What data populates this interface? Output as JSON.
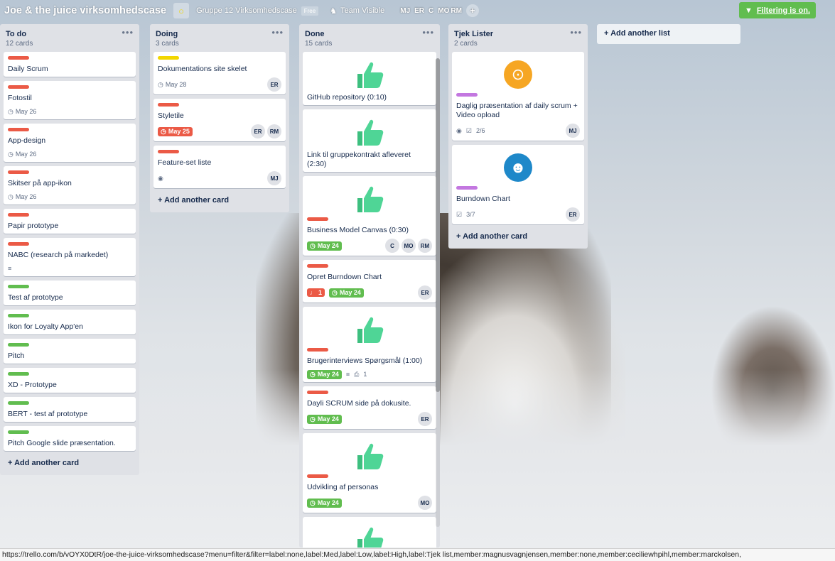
{
  "board": {
    "title": "Joe & the juice virksomhedscase",
    "team": "Gruppe 12 Virksomhedscase",
    "team_badge": "Free",
    "visibility": "Team Visible",
    "members": [
      "MJ",
      "ER",
      "C",
      "MO",
      "RM"
    ],
    "filter_label": "Filtering is on."
  },
  "lists": [
    {
      "name": "To do",
      "count": "12 cards",
      "cards": [
        {
          "labels": [
            "red"
          ],
          "title": "Daily Scrum"
        },
        {
          "labels": [
            "red"
          ],
          "title": "Fotostil",
          "due": "May 26"
        },
        {
          "labels": [
            "red"
          ],
          "title": "App-design",
          "due": "May 26"
        },
        {
          "labels": [
            "red"
          ],
          "title": "Skitser på app-ikon",
          "due": "May 26"
        },
        {
          "labels": [
            "red"
          ],
          "title": "Papir prototype"
        },
        {
          "labels": [
            "red"
          ],
          "title": "NABC (research på markedet)",
          "desc": true
        },
        {
          "labels": [
            "green"
          ],
          "title": "Test af prototype"
        },
        {
          "labels": [
            "green"
          ],
          "title": "Ikon for Loyalty App'en"
        },
        {
          "labels": [
            "green"
          ],
          "title": "Pitch"
        },
        {
          "labels": [
            "green"
          ],
          "title": "XD - Prototype"
        },
        {
          "labels": [
            "green"
          ],
          "title": "BERT - test af prototype"
        },
        {
          "labels": [
            "green"
          ],
          "title": "Pitch Google slide præsentation."
        }
      ],
      "add_card": "Add another card"
    },
    {
      "name": "Doing",
      "count": "3 cards",
      "cards": [
        {
          "labels": [
            "yellow"
          ],
          "title": "Dokumentations site skelet",
          "due": "May 28",
          "members": [
            "ER"
          ]
        },
        {
          "labels": [
            "red"
          ],
          "title": "Styletile",
          "due": "May 25",
          "due_state": "late",
          "members": [
            "ER",
            "RM"
          ]
        },
        {
          "labels": [
            "red"
          ],
          "title": "Feature-set liste",
          "watch": true,
          "members": [
            "MJ"
          ]
        }
      ],
      "add_card": "Add another card"
    },
    {
      "name": "Done",
      "count": "15 cards",
      "cards": [
        {
          "cover": "thumb",
          "title": "GitHub repository (0:10)"
        },
        {
          "cover": "thumb",
          "title": "Link til gruppekontrakt afleveret (2:30)"
        },
        {
          "cover": "thumb",
          "labels": [
            "red"
          ],
          "title": "Business Model Canvas (0:30)",
          "due": "May 24",
          "due_state": "ok",
          "members": [
            "C",
            "MO",
            "RM"
          ]
        },
        {
          "labels": [
            "red"
          ],
          "title": "Opret Burndown Chart",
          "alert": "1",
          "due": "May 24",
          "due_state": "ok",
          "members": [
            "ER"
          ]
        },
        {
          "cover": "thumb",
          "labels": [
            "red"
          ],
          "title": "Brugerinterviews Spørgsmål (1:00)",
          "due": "May 24",
          "due_state": "ok",
          "desc": true,
          "attach": "1"
        },
        {
          "labels": [
            "red"
          ],
          "title": "Dayli SCRUM side på dokusite.",
          "due": "May 24",
          "due_state": "ok",
          "members": [
            "ER"
          ]
        },
        {
          "cover": "thumb",
          "labels": [
            "red"
          ],
          "title": "Udvikling af personas",
          "due": "May 24",
          "due_state": "ok",
          "members": [
            "MO"
          ]
        },
        {
          "cover": "thumb",
          "labels": [
            "red"
          ],
          "title": ""
        }
      ],
      "add_card": "Add another card"
    },
    {
      "name": "Tjek Lister",
      "count": "2 cards",
      "cards": [
        {
          "cover": "emoji-orange",
          "labels": [
            "purple"
          ],
          "title": "Daglig præsentation af daily scrum + Video opload",
          "watch": true,
          "checklist": "2/6",
          "members": [
            "MJ"
          ]
        },
        {
          "cover": "emoji-blue",
          "labels": [
            "purple"
          ],
          "title": "Burndown Chart",
          "checklist": "3/7",
          "members": [
            "ER"
          ]
        }
      ],
      "add_card": "Add another card"
    }
  ],
  "add_list": "Add another list",
  "status_url": "https://trello.com/b/vOYX0DtR/joe-the-juice-virksomhedscase?menu=filter&filter=label:none,label:Med,label:Low,label:High,label:Tjek list,member:magnusvagnjensen,member:none,member:ceciliewhpihl,member:marckolsen,"
}
